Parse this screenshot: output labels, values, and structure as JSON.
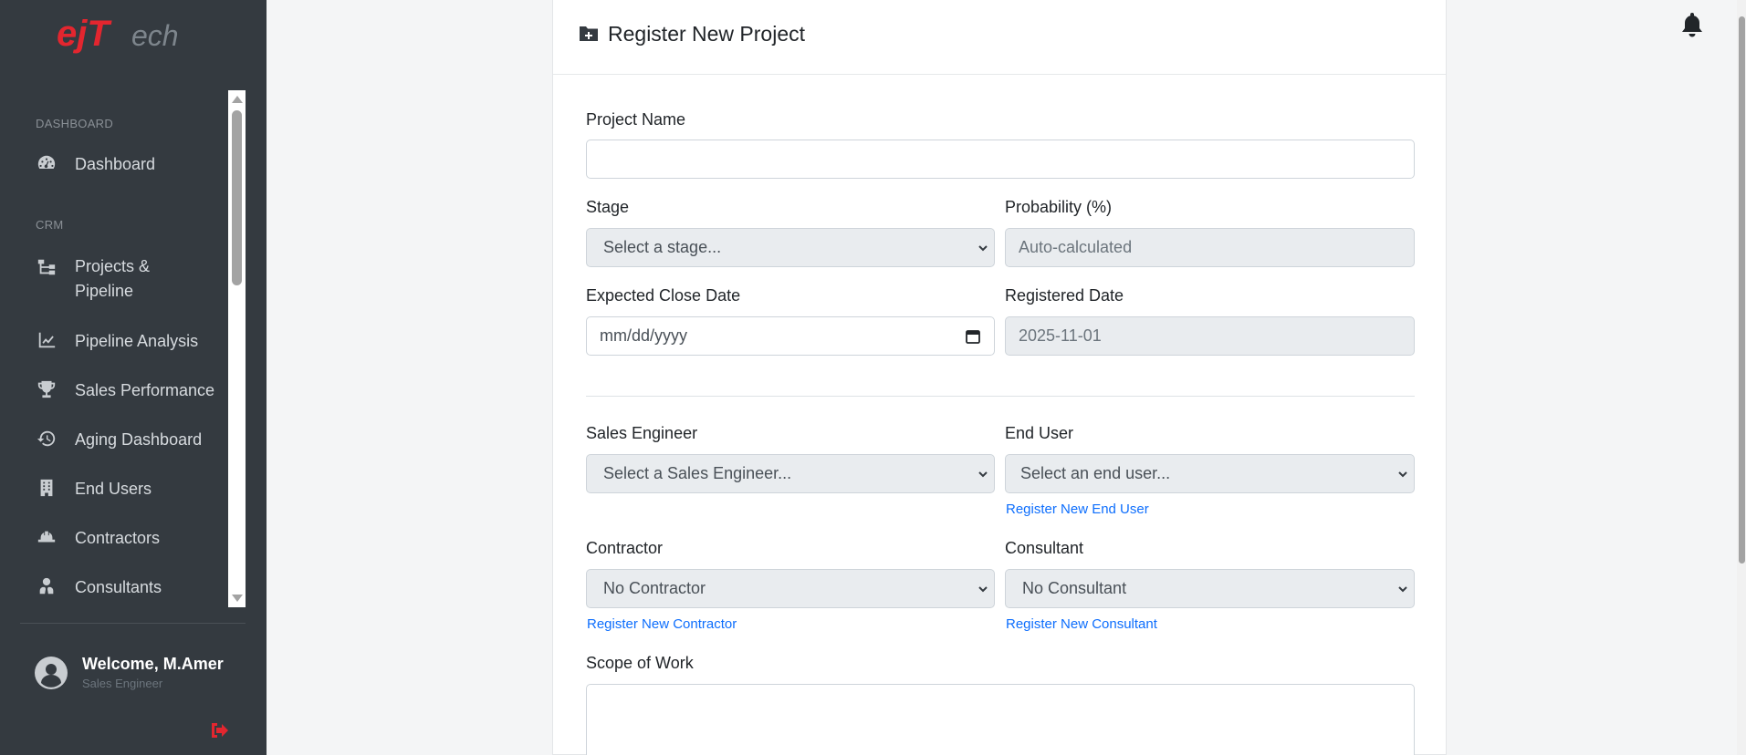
{
  "brand": {
    "logo_text": "ejTech",
    "accent": "#e3262f"
  },
  "sidebar": {
    "sections": [
      {
        "label": "DASHBOARD"
      },
      {
        "label": "CRM"
      }
    ],
    "items": [
      {
        "label": "Dashboard",
        "icon": "gauge-icon"
      },
      {
        "label": "Projects & Pipeline",
        "icon": "sitemap-icon"
      },
      {
        "label": "Pipeline Analysis",
        "icon": "chart-line-icon"
      },
      {
        "label": "Sales Performance",
        "icon": "trophy-icon"
      },
      {
        "label": "Aging Dashboard",
        "icon": "history-icon"
      },
      {
        "label": "End Users",
        "icon": "building-icon"
      },
      {
        "label": "Contractors",
        "icon": "hard-hat-icon"
      },
      {
        "label": "Consultants",
        "icon": "user-tie-icon"
      }
    ],
    "user": {
      "welcome": "Welcome, M.Amer",
      "role": "Sales Engineer"
    }
  },
  "form": {
    "title": "Register New Project",
    "project_name": {
      "label": "Project Name",
      "value": ""
    },
    "stage": {
      "label": "Stage",
      "selected": "Select a stage..."
    },
    "probability": {
      "label": "Probability (%)",
      "placeholder": "Auto-calculated"
    },
    "expected_close": {
      "label": "Expected Close Date",
      "placeholder": "mm/dd/yyyy"
    },
    "registered_date": {
      "label": "Registered Date",
      "value": "2025-11-01"
    },
    "sales_engineer": {
      "label": "Sales Engineer",
      "selected": "Select a Sales Engineer..."
    },
    "end_user": {
      "label": "End User",
      "selected": "Select an end user...",
      "link": "Register New End User"
    },
    "contractor": {
      "label": "Contractor",
      "selected": "No Contractor",
      "link": "Register New Contractor"
    },
    "consultant": {
      "label": "Consultant",
      "selected": "No Consultant",
      "link": "Register New Consultant"
    },
    "scope": {
      "label": "Scope of Work"
    }
  }
}
